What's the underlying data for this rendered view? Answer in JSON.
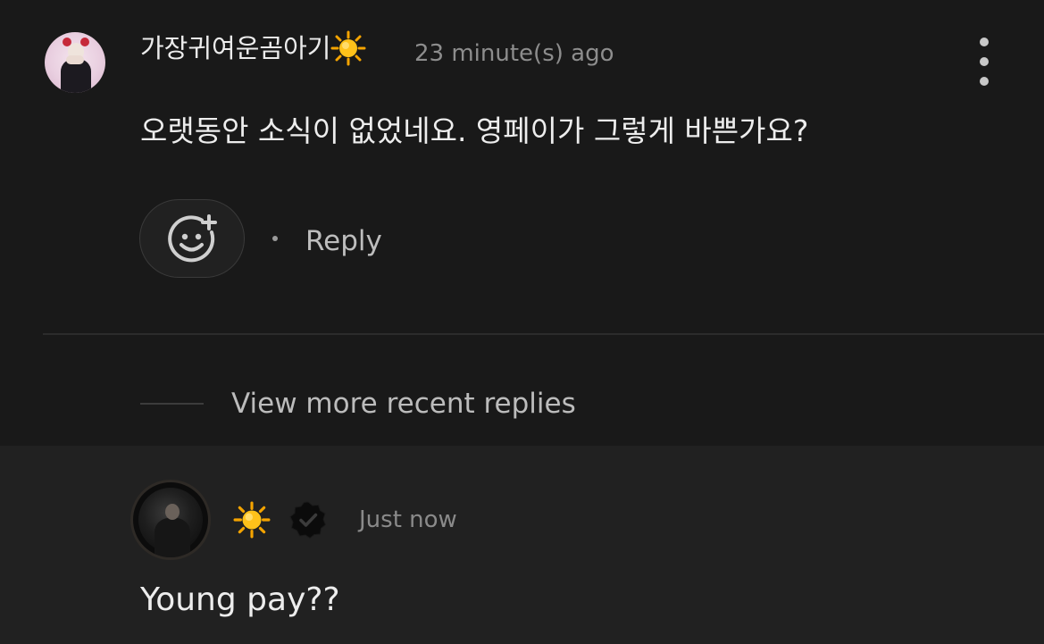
{
  "comment": {
    "username": "가장귀여운곰아기",
    "username_emoji": "sun-emoji",
    "timestamp": "23 minute(s) ago",
    "text": "오랫동안 소식이 없었네요. 영페이가 그렇게 바쁜가요?",
    "reply_label": "Reply",
    "more_icon": "more-vertical-icon",
    "reaction_icon": "add-reaction-icon"
  },
  "thread": {
    "view_more_label": "View more recent replies"
  },
  "reply": {
    "username_emoji": "sun-emoji",
    "badge_icon": "verified-badge-icon",
    "timestamp": "Just now",
    "text": "Young pay??"
  },
  "colors": {
    "background": "#191919",
    "reply_background": "#212121",
    "text_primary": "#ededed",
    "text_secondary": "#8d8d8d",
    "sun": "#f7b500"
  }
}
